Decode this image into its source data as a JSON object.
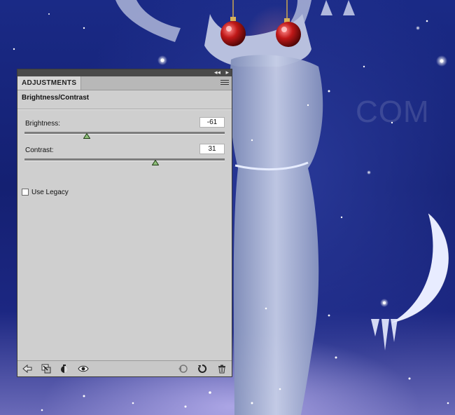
{
  "panel": {
    "tab_label": "ADJUSTMENTS",
    "title": "Brightness/Contrast",
    "collapse_glyph": "◂◂",
    "close_glyph": "▸",
    "brightness": {
      "label": "Brightness:",
      "value": "-61",
      "fraction": 0.31
    },
    "contrast": {
      "label": "Contrast:",
      "value": "31",
      "fraction": 0.655
    },
    "legacy": {
      "label": "Use Legacy",
      "checked": false
    }
  },
  "canvas": {
    "watermark_text": "COM"
  },
  "icons": {
    "back": "arrow-left-icon",
    "clip": "clip-to-layer-icon",
    "view_previous": "view-previous-state-icon",
    "visibility": "eye-icon",
    "previous_state": "previous-state-icon",
    "reset": "reset-icon",
    "delete": "trash-icon"
  },
  "colors": {
    "panel_bg": "#cfcfcf",
    "thumb_fill": "#8fbf7a",
    "night_sky": "#1a2a86"
  }
}
